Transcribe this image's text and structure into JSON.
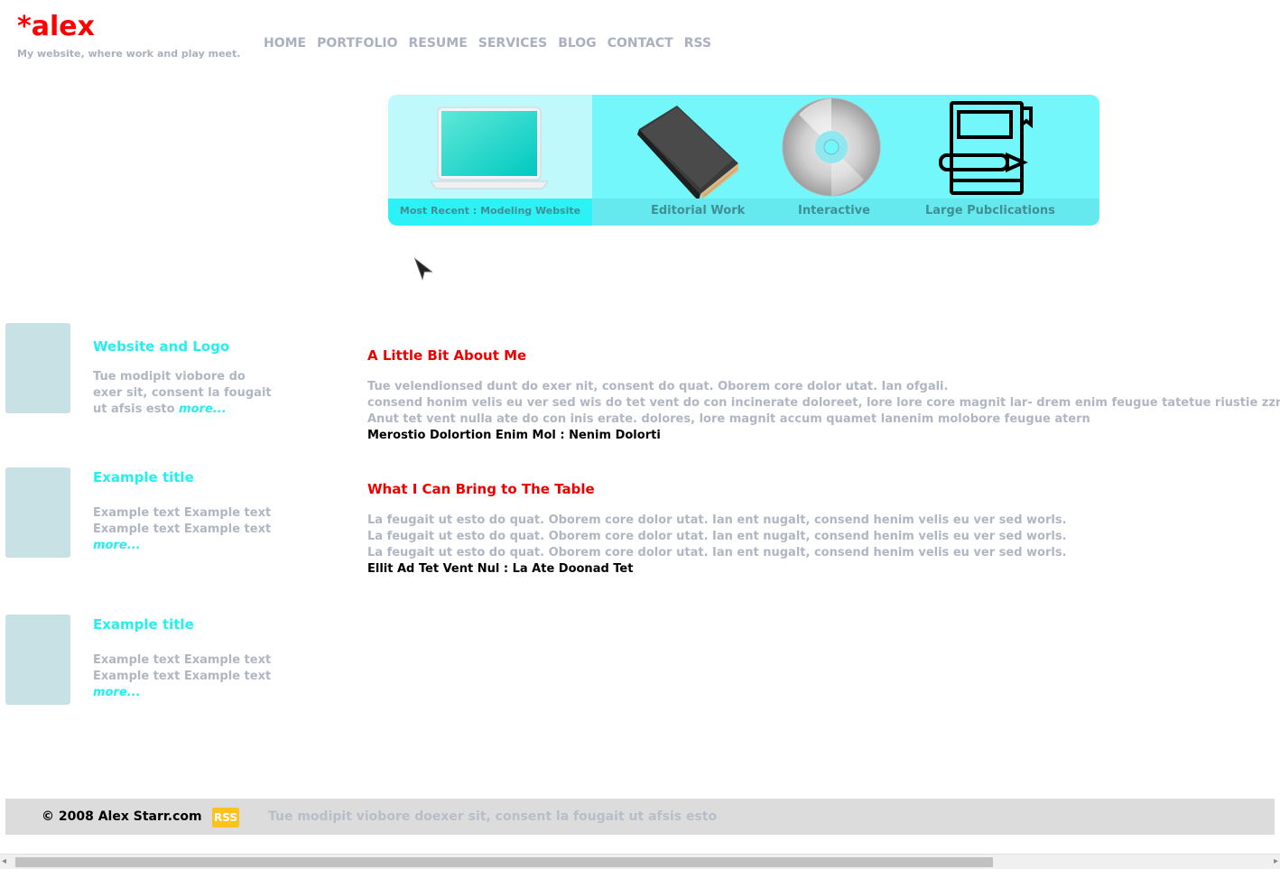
{
  "header": {
    "logo_star": "*",
    "logo_text": "alex",
    "tagline": "My website, where work and play meet."
  },
  "nav": [
    "HOME",
    "PORTFOLIO",
    "RESUME",
    "SERVICES",
    "BLOG",
    "CONTACT",
    "RSS"
  ],
  "showcase": {
    "recent_caption": "Most Recent : Modeling Website",
    "categories": [
      "Editorial Work",
      "Interactive",
      "Large Pubclications"
    ]
  },
  "sidebar": [
    {
      "title": "Website and Logo",
      "text": "Tue modipit viobore do exer sit, consent la fougait ut afsis esto",
      "more": "more..."
    },
    {
      "title": "Example title",
      "text": "Example text Example text Example text Example text",
      "more": "more..."
    },
    {
      "title": "Example title",
      "text": "Example text Example text Example text Example text",
      "more": "more..."
    }
  ],
  "main": {
    "sections": [
      {
        "title": "A Little Bit About Me",
        "lines": [
          "Tue velendionsed dunt do exer nit, consent do quat. Oborem core dolor utat. Ian ofgali.",
          "consend honim velis eu ver sed wis do tet vent do con incinerate doloreet, lore lore core magnit lar- drem enim feugue tatetue riustie zzril.",
          "Anut tet vent nulla ate do con inis erate. dolores, lore magnit accum quamet lanenim molobore feugue atern"
        ],
        "strong": "Merostio Dolortion Enim Mol : Nenim Dolorti"
      },
      {
        "title": "What I Can Bring to The Table",
        "lines": [
          "La feugait ut esto do quat. Oborem core dolor utat. Ian ent nugalt, consend henim velis eu ver sed worls.",
          "La feugait ut esto do quat. Oborem core dolor utat. Ian ent nugalt, consend henim velis eu ver sed worls.",
          "La feugait ut esto do quat. Oborem core dolor utat. Ian ent nugalt, consend henim velis eu ver sed worls."
        ],
        "strong": "Ellit Ad Tet Vent Nul : La Ate Doonad Tet"
      }
    ]
  },
  "footer": {
    "copyright": "© 2008 Alex Starr.com",
    "rss_badge": "RSS",
    "text": "Tue modipit viobore doexer sit, consent la fougait ut afsis esto"
  },
  "icons": [
    "laptop-icon",
    "book-icon",
    "cd-icon",
    "notebook-icon",
    "cursor-icon"
  ],
  "colors": {
    "logo": "#ff0000",
    "accent_cyan": "#22f0f0",
    "showcase_bg": "#74f7fb",
    "section_title": "#ee0000",
    "muted_text": "#b0b6c2",
    "rss_badge": "#ffc21c"
  }
}
